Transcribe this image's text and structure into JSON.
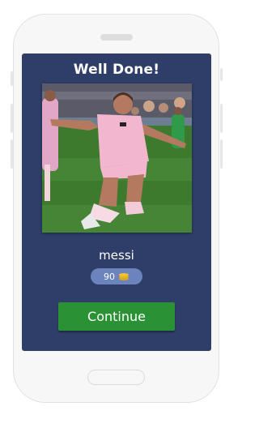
{
  "result": {
    "title": "Well Done!",
    "answer": "messi",
    "coins": "90",
    "continue_label": "Continue"
  },
  "icons": {
    "coin": "coins-icon"
  },
  "colors": {
    "screen_background": "#2e3e68",
    "coins_badge": "#6c84bd",
    "continue_button": "#2a9135",
    "coin": "#f2c230"
  }
}
